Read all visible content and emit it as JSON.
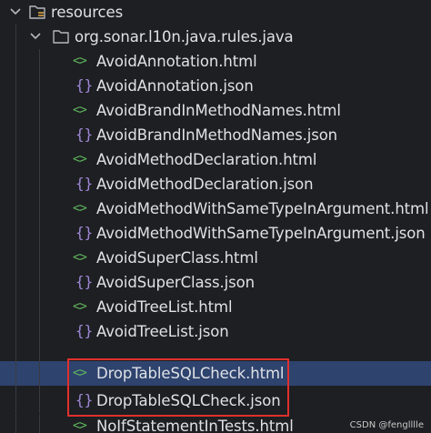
{
  "tree": {
    "resources_label": "resources",
    "package_label": "org.sonar.l10n.java.rules.java",
    "html_icon_glyph": "<>",
    "json_icon_glyph": "{}",
    "files": [
      {
        "name": "AvoidAnnotation.html",
        "type": "html",
        "selected": false
      },
      {
        "name": "AvoidAnnotation.json",
        "type": "json",
        "selected": false
      },
      {
        "name": "AvoidBrandInMethodNames.html",
        "type": "html",
        "selected": false
      },
      {
        "name": "AvoidBrandInMethodNames.json",
        "type": "json",
        "selected": false
      },
      {
        "name": "AvoidMethodDeclaration.html",
        "type": "html",
        "selected": false
      },
      {
        "name": "AvoidMethodDeclaration.json",
        "type": "json",
        "selected": false
      },
      {
        "name": "AvoidMethodWithSameTypeInArgument.html",
        "type": "html",
        "selected": false
      },
      {
        "name": "AvoidMethodWithSameTypeInArgument.json",
        "type": "json",
        "selected": false
      },
      {
        "name": "AvoidSuperClass.html",
        "type": "html",
        "selected": false
      },
      {
        "name": "AvoidSuperClass.json",
        "type": "json",
        "selected": false
      },
      {
        "name": "AvoidTreeList.html",
        "type": "html",
        "selected": false
      },
      {
        "name": "AvoidTreeList.json",
        "type": "json",
        "selected": false
      },
      {
        "name": "DropTableSQLCheck.html",
        "type": "html",
        "selected": true
      },
      {
        "name": "DropTableSQLCheck.json",
        "type": "json",
        "selected": false
      },
      {
        "name": "NoIfStatementInTests.html",
        "type": "html",
        "selected": false
      }
    ]
  },
  "watermark": "CSDN @fenglllle",
  "colors": {
    "background": "#1e1f22",
    "text": "#dfe1e5",
    "selection": "#2e436e",
    "html_icon": "#5fb85f",
    "json_icon": "#9e88d7",
    "highlight_box": "#e0302d"
  }
}
